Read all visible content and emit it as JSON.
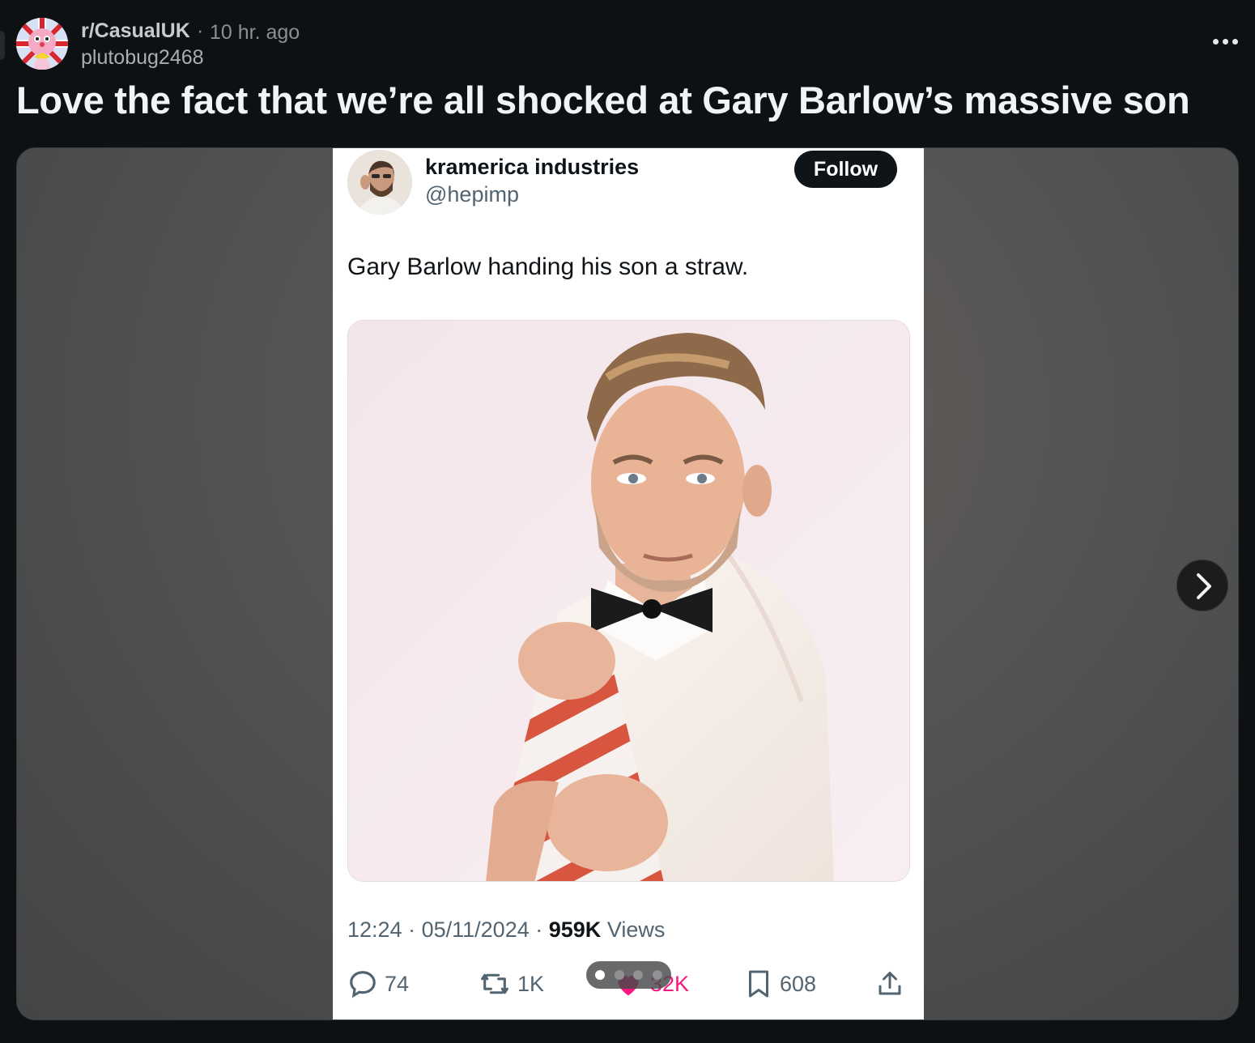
{
  "post": {
    "subreddit": "r/CasualUK",
    "separator": "·",
    "time_ago": "10 hr. ago",
    "username": "plutobug2468",
    "title": "Love the fact that we’re all shocked at Gary Barlow’s massive son",
    "more_icon": "more-horizontal-icon"
  },
  "tweet": {
    "display_name": "kramerica industries",
    "handle": "@hepimp",
    "follow_label": "Follow",
    "text": "Gary Barlow handing his son a straw.",
    "time": "12:24",
    "date": "05/11/2024",
    "views_count": "959K",
    "views_label": "Views",
    "replies": "74",
    "reposts": "1K",
    "likes": "32K",
    "bookmarks": "608"
  },
  "gallery": {
    "current_index": 1,
    "total": 4,
    "next_icon": "chevron-right-icon"
  },
  "colors": {
    "page_bg": "#0e1113",
    "like_pink": "#f91880",
    "tweet_text": "#0f1419",
    "tweet_secondary": "#536471"
  }
}
